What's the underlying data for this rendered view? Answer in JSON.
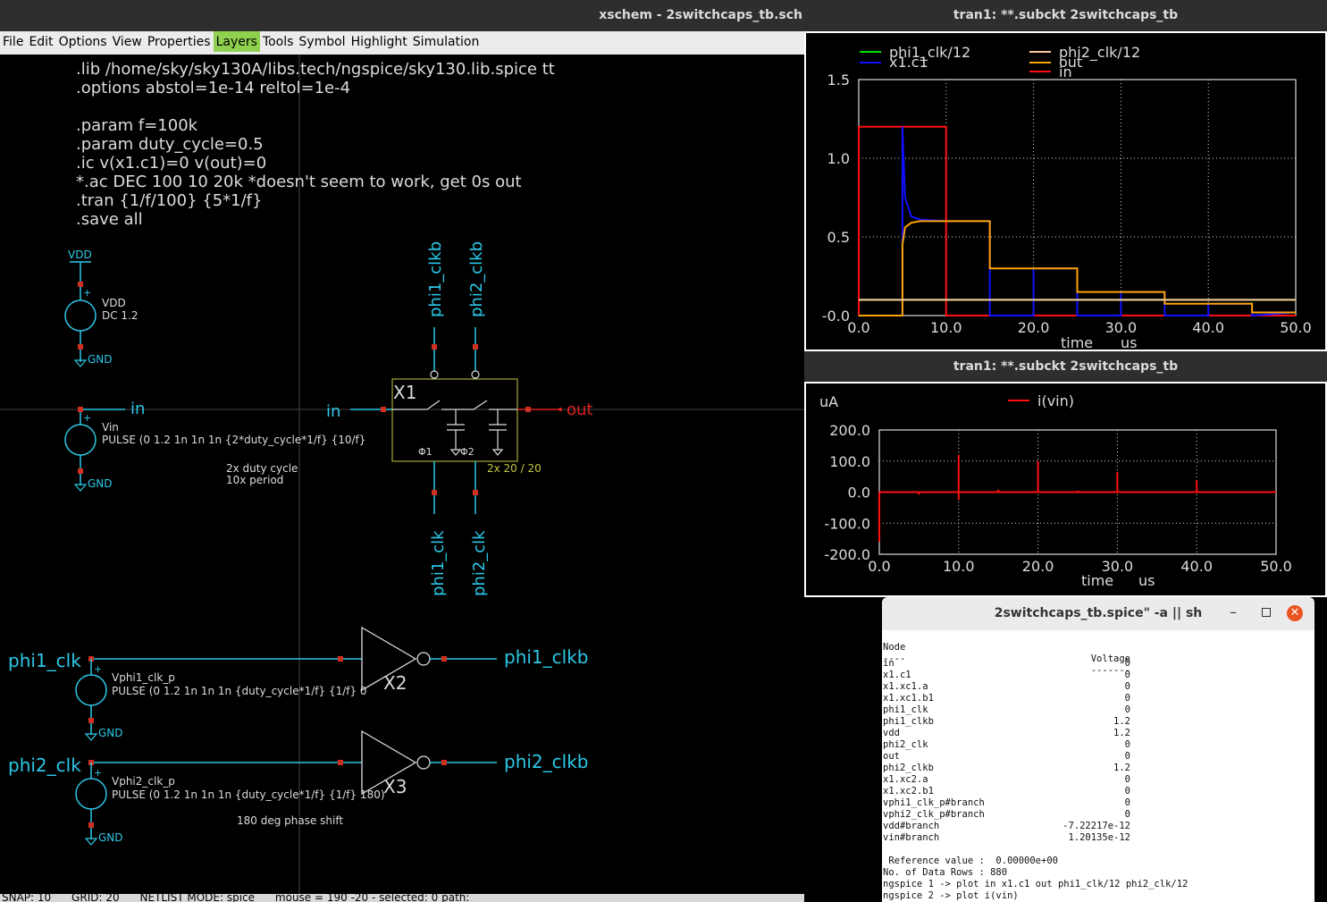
{
  "xschem": {
    "title": "xschem - 2switchcaps_tb.sch",
    "menu": [
      "File",
      "Edit",
      "Options",
      "View",
      "Properties",
      "Layers",
      "Tools",
      "Symbol",
      "Highlight",
      "Simulation"
    ],
    "active_menu": "Layers",
    "spice_lines": [
      ".lib /home/sky/sky130A/libs.tech/ngspice/sky130.lib.spice tt",
      ".options abstol=1e-14 reltol=1e-4",
      "",
      ".param f=100k",
      ".param duty_cycle=0.5",
      ".ic v(x1.c1)=0 v(out)=0",
      "*.ac DEC 100 10 20k *doesn't seem to work, get 0s out",
      ".tran {1/f/100} {5*1/f}",
      ".save all"
    ],
    "labels": {
      "vdd_net": "VDD",
      "vdd_name": "VDD",
      "vdd_value": "DC 1.2",
      "gnd": "GND",
      "in": "in",
      "out": "out",
      "vin_name": "Vin",
      "vin_value": "PULSE (0 1.2 1n 1n 1n {2*duty_cycle*1/f} {10/f}",
      "note1": "2x duty cycle",
      "note2": "10x period",
      "x1": "X1",
      "phi1": "Φ1",
      "phi2": "Φ2",
      "x1_caps": "2x 20 / 20",
      "phi1_clkb": "phi1_clkb",
      "phi2_clkb": "phi2_clkb",
      "phi1_clk": "phi1_clk",
      "phi2_clk": "phi2_clk",
      "x2": "X2",
      "x3": "X3",
      "vphi1_name": "Vphi1_clk_p",
      "vphi1_value": "PULSE (0 1.2 1n 1n 1n {duty_cycle*1/f} {1/f} 0",
      "vphi2_name": "Vphi2_clk_p",
      "vphi2_value": "PULSE (0 1.2 1n 1n 1n {duty_cycle*1/f} {1/f} 180)",
      "phase_note": "180 deg phase shift"
    },
    "status": "SNAP: 10      GRID: 20      NETLIST MODE: spice      mouse = 190 -20 - selected: 0 path:"
  },
  "wave1": {
    "title": "tran1: **.subckt 2switchcaps_tb",
    "xlabel": "time",
    "xunit": "us",
    "legend": [
      {
        "name": "phi1_clk/12",
        "color": "#00e000"
      },
      {
        "name": "phi2_clk/12",
        "color": "#ffc8a0"
      },
      {
        "name": "x1.c1",
        "color": "#1010ff"
      },
      {
        "name": "out",
        "color": "#ffa500"
      },
      {
        "name": "in",
        "color": "#ff1010"
      }
    ]
  },
  "wave2": {
    "title": "tran1: **.subckt 2switchcaps_tb",
    "xlabel": "time",
    "xunit": "us",
    "yunit": "uA",
    "legend": [
      {
        "name": "i(vin)",
        "color": "#ff1010"
      }
    ]
  },
  "chart_data": [
    {
      "type": "line",
      "title": "tran1: **.subckt 2switchcaps_tb",
      "xlabel": "time",
      "xunit": "us",
      "xlim": [
        0,
        50
      ],
      "ylim": [
        0,
        1.5
      ],
      "xticks": [
        "0.0",
        "10.0",
        "20.0",
        "30.0",
        "40.0",
        "50.0"
      ],
      "yticks": [
        "-0.0",
        "0.5",
        "1.0",
        "1.5"
      ],
      "grid": true,
      "series": [
        {
          "name": "in",
          "color": "#ff1010",
          "x": [
            0,
            0,
            10,
            10,
            50
          ],
          "y": [
            0,
            1.2,
            1.2,
            0,
            0
          ]
        },
        {
          "name": "x1.c1",
          "color": "#1010ff",
          "x": [
            0,
            5,
            5,
            5.3,
            6,
            7,
            10,
            15,
            15,
            20,
            20,
            25,
            25,
            30,
            30,
            35,
            35,
            40,
            40,
            45,
            45,
            50
          ],
          "y": [
            0,
            0,
            1.2,
            0.75,
            0.63,
            0.61,
            0.6,
            0.6,
            0,
            0,
            0.3,
            0.3,
            0,
            0,
            0.15,
            0.15,
            0,
            0,
            0.075,
            0.075,
            0,
            0.02
          ]
        },
        {
          "name": "out",
          "color": "#ffa500",
          "x": [
            0,
            5,
            5,
            5.3,
            6,
            7,
            10,
            15,
            15,
            20,
            20,
            25,
            25,
            30,
            30,
            35,
            35,
            40,
            40,
            45,
            45,
            50
          ],
          "y": [
            0,
            0,
            0.45,
            0.56,
            0.59,
            0.6,
            0.6,
            0.6,
            0.3,
            0.3,
            0.3,
            0.3,
            0.15,
            0.15,
            0.15,
            0.15,
            0.075,
            0.075,
            0.075,
            0.075,
            0.02,
            0.02
          ]
        },
        {
          "name": "phi1_clk/12",
          "color": "#00e000",
          "x": [
            0,
            50
          ],
          "y": [
            0.1,
            0.1
          ]
        },
        {
          "name": "phi2_clk/12",
          "color": "#ffc8a0",
          "x": [
            0,
            50
          ],
          "y": [
            0.1,
            0.1
          ]
        }
      ]
    },
    {
      "type": "line",
      "title": "tran1: **.subckt 2switchcaps_tb",
      "xlabel": "time",
      "xunit": "us",
      "ylabel": "uA",
      "xlim": [
        0,
        50
      ],
      "ylim": [
        -200,
        200
      ],
      "xticks": [
        "0.0",
        "10.0",
        "20.0",
        "30.0",
        "40.0",
        "50.0"
      ],
      "yticks": [
        "200.0",
        "100.0",
        "0.0",
        "-100.0",
        "-200.0"
      ],
      "grid": true,
      "series": [
        {
          "name": "i(vin)",
          "color": "#ff1010",
          "spikes": [
            [
              0,
              -160
            ],
            [
              5,
              -8
            ],
            [
              10,
              -25
            ],
            [
              10,
              120
            ],
            [
              15,
              8
            ],
            [
              20,
              100
            ],
            [
              25,
              5
            ],
            [
              30,
              65
            ],
            [
              35,
              3
            ],
            [
              40,
              38
            ],
            [
              45,
              2
            ]
          ]
        }
      ]
    }
  ],
  "terminal": {
    "title": "2switchcaps_tb.spice\" -a || sh",
    "header": [
      "Node",
      "Voltage"
    ],
    "header_rule": [
      "----",
      "-------"
    ],
    "rows": [
      [
        "in",
        "0"
      ],
      [
        "x1.c1",
        "0"
      ],
      [
        "x1.xc1.a",
        "0"
      ],
      [
        "x1.xc1.b1",
        "0"
      ],
      [
        "phi1_clk",
        "0"
      ],
      [
        "phi1_clkb",
        "1.2"
      ],
      [
        "vdd",
        "1.2"
      ],
      [
        "phi2_clk",
        "0"
      ],
      [
        "out",
        "0"
      ],
      [
        "phi2_clkb",
        "1.2"
      ],
      [
        "x1.xc2.a",
        "0"
      ],
      [
        "x1.xc2.b1",
        "0"
      ],
      [
        "vphi1_clk_p#branch",
        "0"
      ],
      [
        "vphi2_clk_p#branch",
        "0"
      ],
      [
        "vdd#branch",
        "-7.22217e-12"
      ],
      [
        "vin#branch",
        "1.20135e-12"
      ]
    ],
    "tail": [
      " Reference value :  0.00000e+00",
      "No. of Data Rows : 880",
      "ngspice 1 -> plot in x1.c1 out phi1_clk/12 phi2_clk/12",
      "ngspice 2 -> plot i(vin)"
    ]
  }
}
